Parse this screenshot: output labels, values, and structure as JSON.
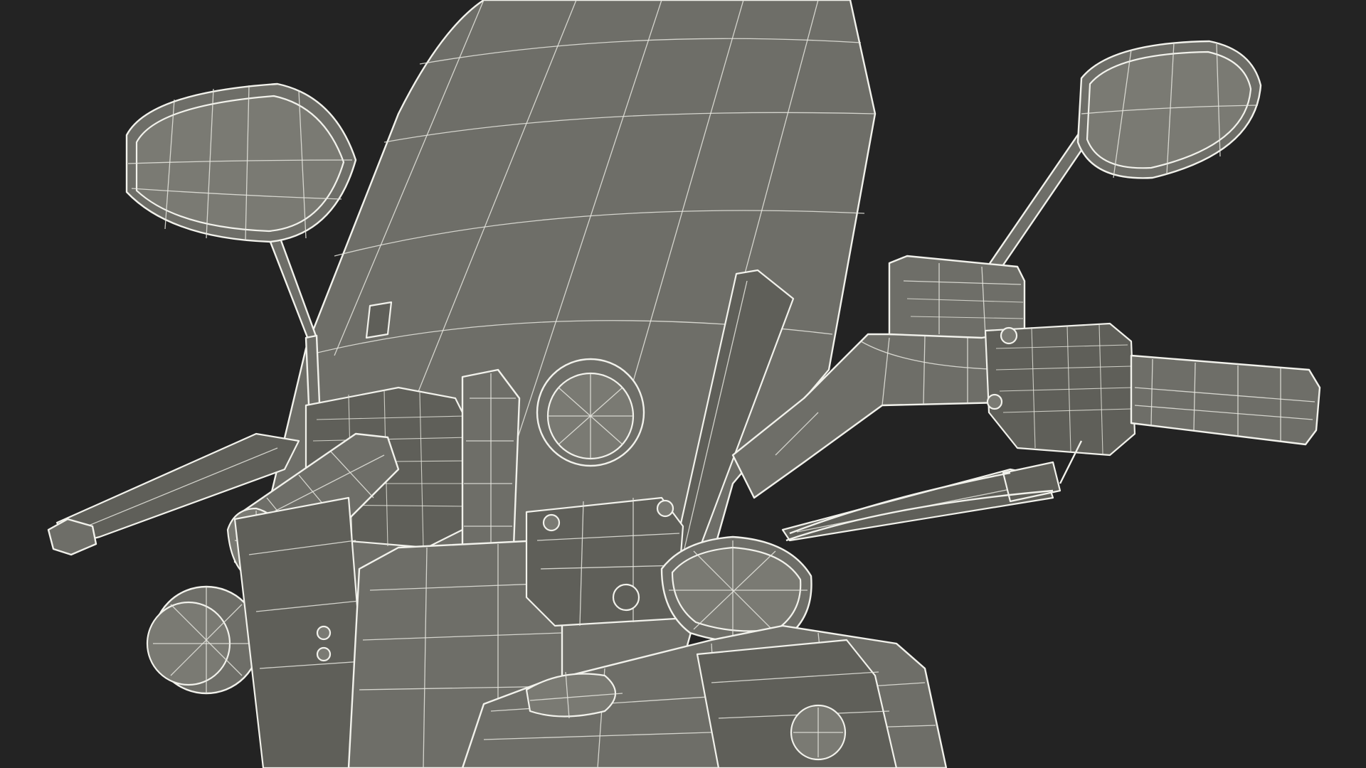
{
  "image": {
    "background_color": "#232323",
    "mesh_fill_color": "#6e6e68",
    "wire_color": "#f2f2ec"
  }
}
